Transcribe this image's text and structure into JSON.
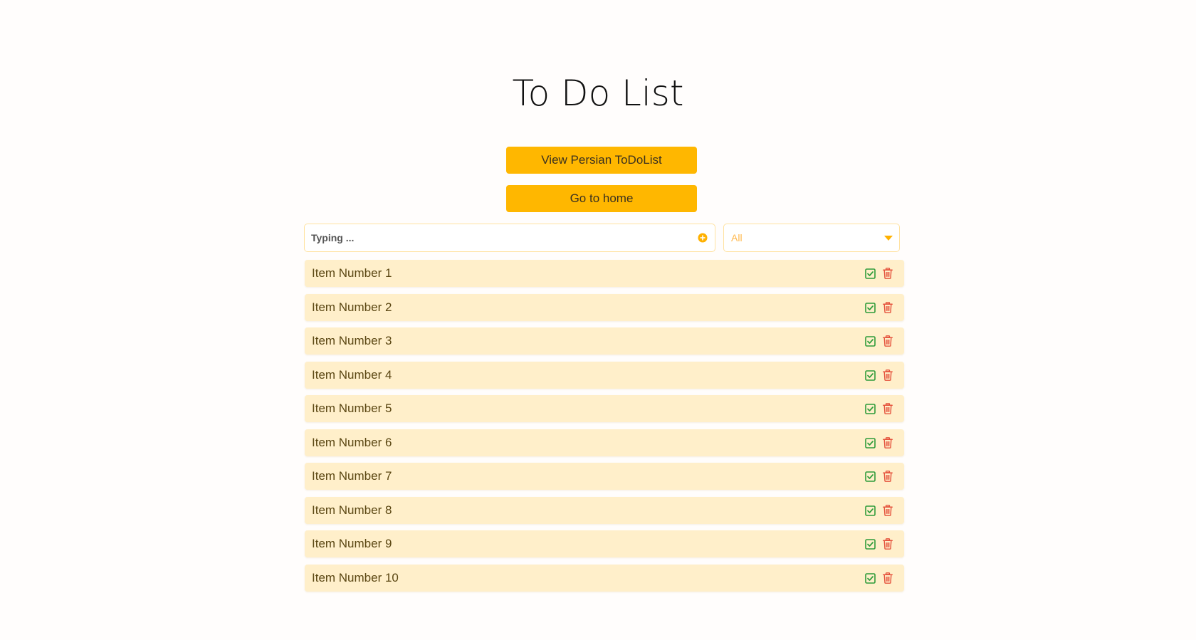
{
  "header": {
    "title": "To Do List"
  },
  "actions": {
    "persian_label": "View Persian ToDoList",
    "home_label": "Go to home"
  },
  "form": {
    "input_placeholder": "Typing ...",
    "input_value": "",
    "filter_selected": "All",
    "add_icon": "plus-circle-icon",
    "dropdown_icon": "caret-down-icon"
  },
  "items": [
    {
      "label": "Item Number 1"
    },
    {
      "label": "Item Number 2"
    },
    {
      "label": "Item Number 3"
    },
    {
      "label": "Item Number 4"
    },
    {
      "label": "Item Number 5"
    },
    {
      "label": "Item Number 6"
    },
    {
      "label": "Item Number 7"
    },
    {
      "label": "Item Number 8"
    },
    {
      "label": "Item Number 9"
    },
    {
      "label": "Item Number 10"
    }
  ],
  "item_icons": {
    "complete": "check-square-icon",
    "delete": "trash-icon"
  },
  "colors": {
    "accent": "#ffb700",
    "item_background": "#ffefca",
    "item_text": "#5a4612",
    "check": "#2e9c3a",
    "delete": "#e5533d"
  }
}
